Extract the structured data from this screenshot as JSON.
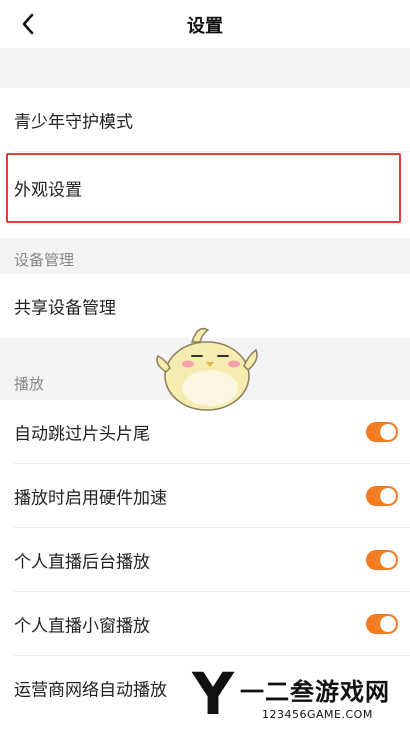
{
  "header": {
    "title": "设置"
  },
  "rows": {
    "youth_mode": "青少年守护模式",
    "appearance": "外观设置",
    "shared_devices": "共享设备管理",
    "skip_intro": "自动跳过片头片尾",
    "hw_accel": "播放时启用硬件加速",
    "live_bg": "个人直播后台播放",
    "live_mini": "个人直播小窗播放",
    "carrier_auto": "运营商网络自动播放"
  },
  "sections": {
    "device_management": "设备管理",
    "playback": "播放"
  },
  "toggles": {
    "skip_intro": true,
    "hw_accel": true,
    "live_bg": true,
    "live_mini": true
  },
  "colors": {
    "accent": "#f07b20",
    "highlight_border": "#e53b3b",
    "section_bg": "#f4f4f6"
  },
  "watermark": {
    "letter": "Y",
    "text": "一二叁游戏网",
    "url": "123456GAME.COM"
  }
}
